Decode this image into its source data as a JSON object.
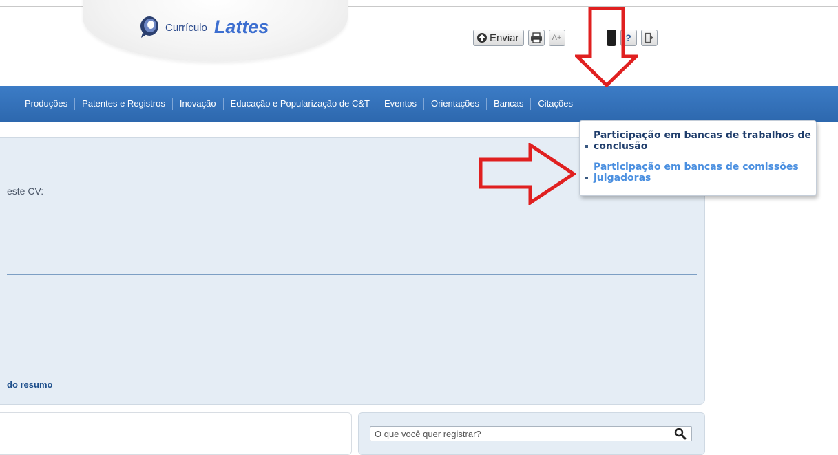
{
  "header": {
    "logo_small": "Currículo",
    "logo_big": "Lattes"
  },
  "toolbar": {
    "send_label": "Enviar",
    "font_increase_label": "A+",
    "help_label": "?"
  },
  "nav": {
    "items": [
      "Produções",
      "Patentes e Registros",
      "Inovação",
      "Educação e Popularização de C&T",
      "Eventos",
      "Orientações",
      "Bancas",
      "Citações"
    ]
  },
  "dropdown": {
    "items": [
      "Participação em bancas de trabalhos de conclusão",
      "Participação em bancas de comissões julgadoras"
    ]
  },
  "main": {
    "cv_text": "este CV:",
    "resumo_link": "do resumo"
  },
  "search": {
    "placeholder": "O que você quer registrar?"
  },
  "colors": {
    "nav_bar": "#3c7cc6",
    "annotation_arrow": "#e02020",
    "dropdown_highlight": "#4a8fe0"
  }
}
